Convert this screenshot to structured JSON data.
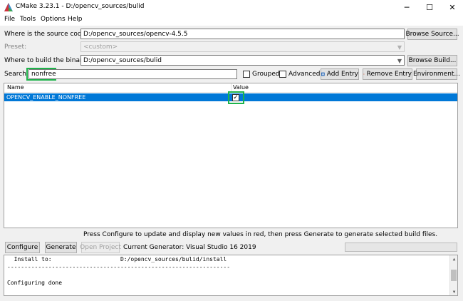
{
  "window": {
    "title": "CMake 3.23.1 - D:/opencv_sources/bulid",
    "minimize_glyph": "─",
    "maximize_glyph": "☐",
    "close_glyph": "✕"
  },
  "menu": {
    "file": "File",
    "tools": "Tools",
    "options": "Options",
    "help": "Help"
  },
  "source": {
    "label": "Where is the source code:",
    "value": "D:/opencv_sources/opencv-4.5.5",
    "browse_label": "Browse Source..."
  },
  "preset": {
    "label": "Preset:",
    "value": "<custom>"
  },
  "build": {
    "label": "Where to build the binaries:",
    "value": "D:/opencv_sources/bulid",
    "browse_label": "Browse Build..."
  },
  "toolbar": {
    "search_label": "Search:",
    "search_value": "nonfree",
    "grouped_label": "Grouped",
    "advanced_label": "Advanced",
    "add_entry_label": "Add Entry",
    "remove_entry_label": "Remove Entry",
    "environment_label": "Environment..."
  },
  "table": {
    "col_name": "Name",
    "col_value": "Value",
    "rows": [
      {
        "name": "OPENCV_ENABLE_NONFREE",
        "value_checked": "✓"
      }
    ]
  },
  "status": {
    "hint": "Press Configure to update and display new values in red, then press Generate to generate selected build files.",
    "configure_label": "Configure",
    "generate_label": "Generate",
    "open_project_label": "Open Project",
    "generator_text": "Current Generator: Visual Studio 16 2019"
  },
  "log": {
    "lines": [
      "  Install to:                    D:/opencv_sources/bulid/install",
      "-----------------------------------------------------------------",
      "",
      "Configuring done"
    ]
  },
  "colors": {
    "selection": "#0078d7",
    "highlight": "#1db34a"
  },
  "icons": {
    "app": "cmake-triangle-icon",
    "add": "plus-icon",
    "remove": "x-icon"
  }
}
